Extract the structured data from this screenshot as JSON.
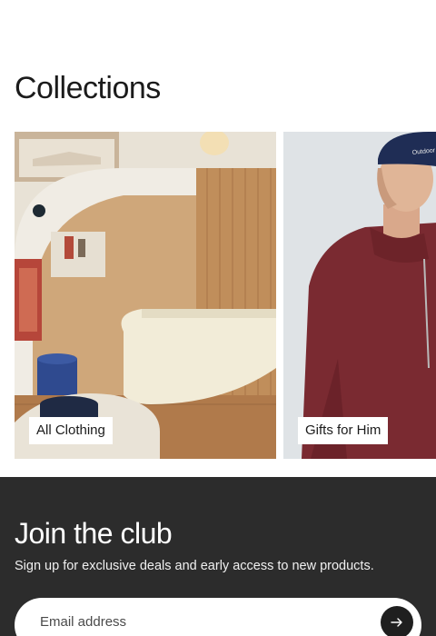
{
  "collections": {
    "title": "Collections",
    "cards": [
      {
        "label": "All Clothing"
      },
      {
        "label": "Gifts for Him"
      }
    ]
  },
  "club": {
    "title": "Join the club",
    "subtitle": "Sign up for exclusive deals and early access to new products.",
    "email_placeholder": "Email address",
    "submit_icon": "arrow-right-icon"
  },
  "colors": {
    "club_background": "#2c2c2c",
    "label_background": "#ffffff",
    "submit_button": "#1f1f1f"
  }
}
